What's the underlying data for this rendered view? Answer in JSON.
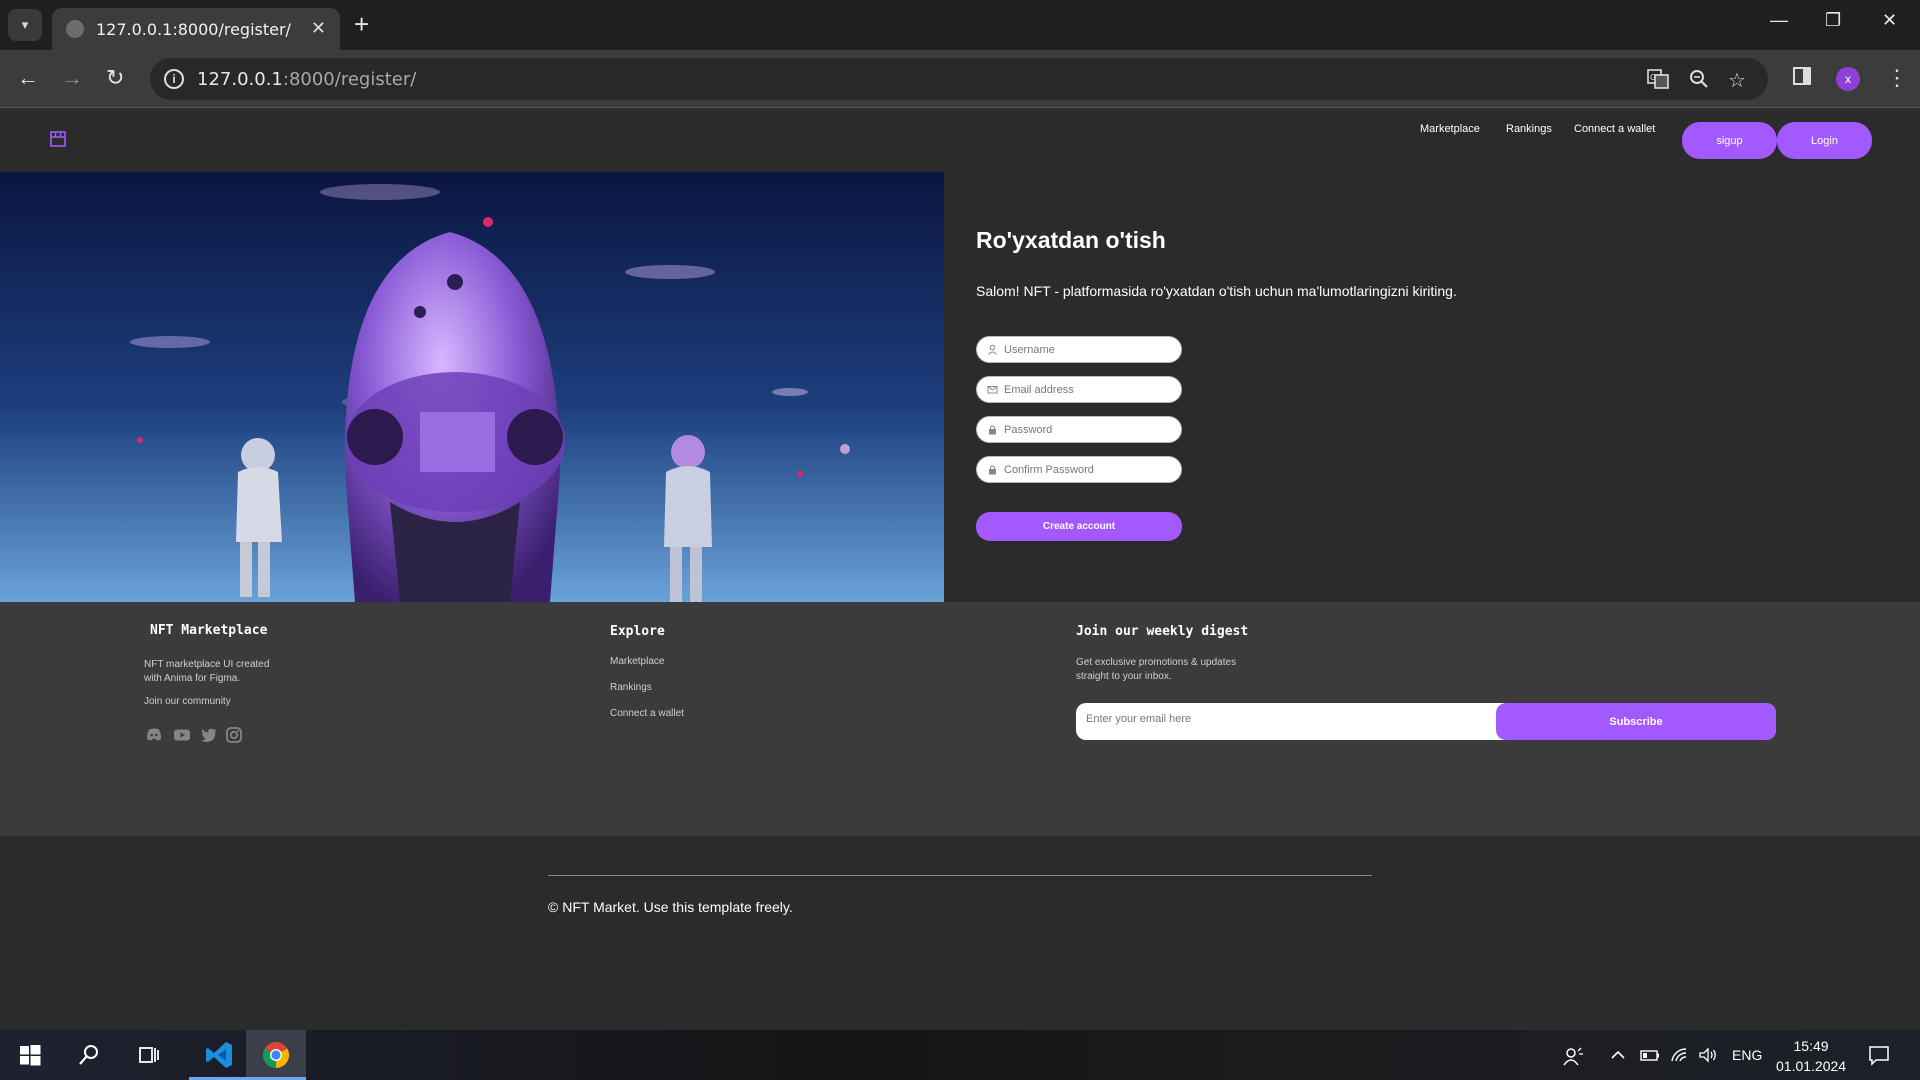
{
  "browser": {
    "tab_title": "127.0.0.1:8000/register/",
    "url_host": "127.0.0.1",
    "url_path": ":8000/register/"
  },
  "header": {
    "nav": [
      "Marketplace",
      "Rankings",
      "Connect a wallet"
    ],
    "signup_label": "sigup",
    "login_label": "Login"
  },
  "form": {
    "title": "Ro'yxatdan o'tish",
    "subtitle": "Salom! NFT - platformasida ro'yxatdan o'tish uchun ma'lumotlaringizni kiriting.",
    "username_placeholder": "Username",
    "email_placeholder": "Email address",
    "password_placeholder": "Password",
    "confirm_placeholder": "Confirm Password",
    "submit_label": "Create account"
  },
  "footer": {
    "brand_title": "NFT Marketplace",
    "brand_desc_1": "NFT marketplace UI created",
    "brand_desc_2": "with Anima for Figma.",
    "community": "Join our community",
    "explore_title": "Explore",
    "explore_links": [
      "Marketplace",
      "Rankings",
      "Connect a wallet"
    ],
    "digest_title": "Join our weekly digest",
    "digest_desc_1": "Get exclusive promotions & updates",
    "digest_desc_2": "straight to your inbox.",
    "email_placeholder": "Enter your email here",
    "subscribe_label": "Subscribe",
    "copyright": "NFT Market. Use this template freely."
  },
  "taskbar": {
    "language": "ENG",
    "time": "15:49",
    "date": "01.01.2024"
  },
  "colors": {
    "accent": "#a259ff",
    "page_bg": "#2b2b2b",
    "footer_bg": "#3b3b3b"
  }
}
